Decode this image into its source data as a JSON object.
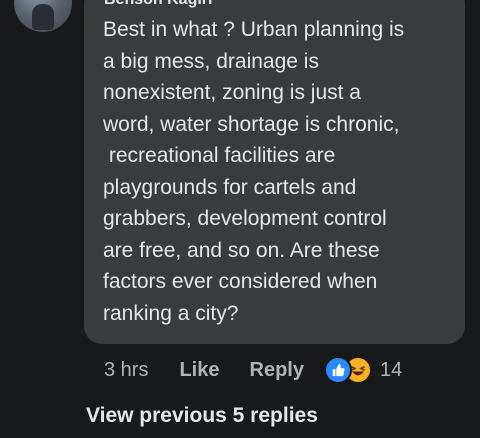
{
  "comment": {
    "author": "Benson Kagiri",
    "text": "Best in what ? Urban planning is\na big mess, drainage is\nnonexistent, zoning is just a\nword, water shortage is chronic,\n recreational facilities are\nplaygrounds for cartels and\ngrabbers, development control\nare free, and so on. Are these\nfactors ever considered when\nranking a city?",
    "time": "3 hrs",
    "like_label": "Like",
    "reply_label": "Reply",
    "reactions": [
      "like-icon",
      "haha-icon"
    ],
    "reaction_count": "14"
  },
  "view_replies_label": "View previous 5 replies",
  "colors": {
    "background": "#18191a",
    "bubble": "#3a3b3c",
    "text_primary": "#e4e6eb",
    "text_secondary": "#b0b3b8",
    "like_blue": "#2d88ff",
    "haha_yellow": "#f7b125"
  }
}
